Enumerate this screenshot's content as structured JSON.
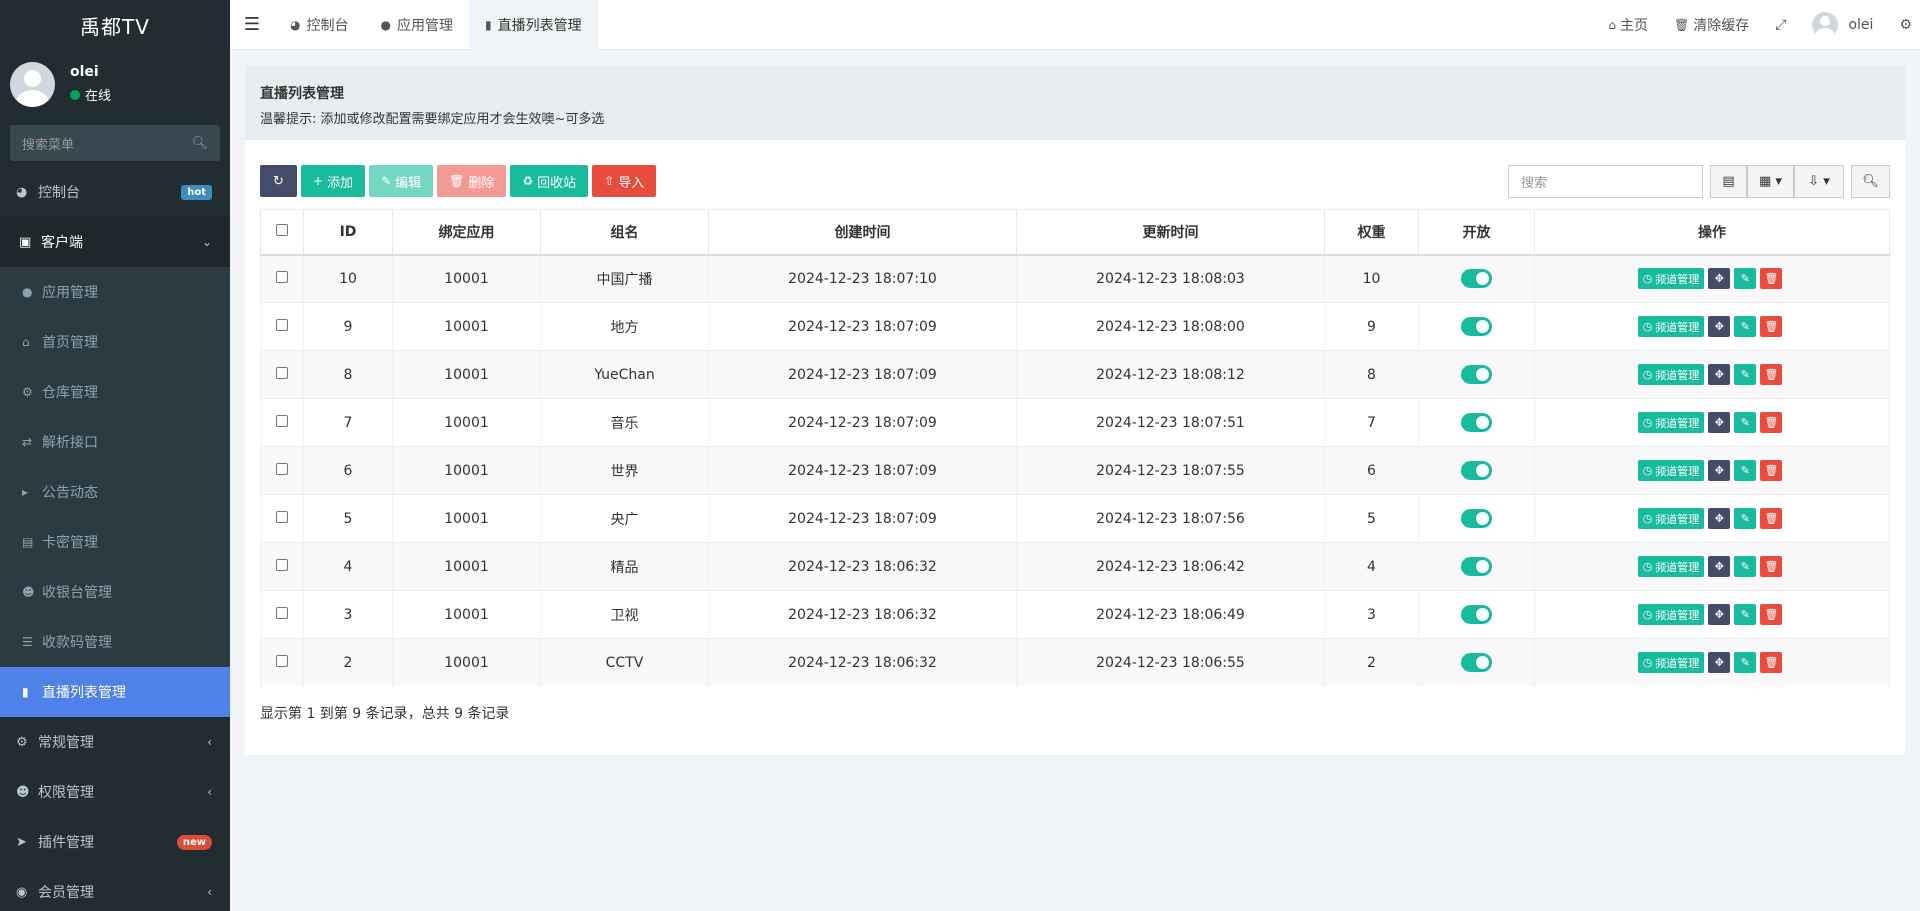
{
  "brand": "禹都TV",
  "user": {
    "name": "olei",
    "status": "在线"
  },
  "sidebar": {
    "search_placeholder": "搜索菜单",
    "items": [
      {
        "label": "控制台",
        "icon": "dashboard-icon",
        "badge": "hot"
      },
      {
        "label": "客户端",
        "icon": "inbox-icon"
      },
      {
        "label": "常规管理",
        "icon": "cogs-icon"
      },
      {
        "label": "权限管理",
        "icon": "users-icon"
      },
      {
        "label": "插件管理",
        "icon": "rocket-icon",
        "badge": "new"
      },
      {
        "label": "会员管理",
        "icon": "user-circle-icon"
      }
    ],
    "sub_items": [
      {
        "label": "应用管理",
        "icon": "android-icon"
      },
      {
        "label": "首页管理",
        "icon": "home-icon"
      },
      {
        "label": "仓库管理",
        "icon": "cogs-icon"
      },
      {
        "label": "解析接口",
        "icon": "usb-icon"
      },
      {
        "label": "公告动态",
        "icon": "bullhorn-icon"
      },
      {
        "label": "卡密管理",
        "icon": "id-card-icon"
      },
      {
        "label": "收银台管理",
        "icon": "user-plus-icon"
      },
      {
        "label": "收款码管理",
        "icon": "list-icon"
      },
      {
        "label": "直播列表管理",
        "icon": "video-icon"
      }
    ]
  },
  "header": {
    "tabs": [
      {
        "label": "控制台",
        "icon": "dashboard-icon"
      },
      {
        "label": "应用管理",
        "icon": "android-icon"
      },
      {
        "label": "直播列表管理",
        "icon": "video-icon"
      }
    ],
    "right": {
      "home": "主页",
      "clear_cache": "清除缓存",
      "user": "olei"
    }
  },
  "page": {
    "title": "直播列表管理",
    "tip": "温馨提示: 添加或修改配置需要绑定应用才会生效噢~可多选",
    "buttons": {
      "add": "添加",
      "edit": "编辑",
      "delete": "删除",
      "recycle": "回收站",
      "import": "导入"
    },
    "search_placeholder": "搜索",
    "summary": "显示第 1 到第 9 条记录，总共 9 条记录"
  },
  "table": {
    "columns": [
      "ID",
      "绑定应用",
      "组名",
      "创建时间",
      "更新时间",
      "权重",
      "开放",
      "操作"
    ],
    "op_label": "频道管理",
    "rows": [
      {
        "id": "10",
        "app": "10001",
        "group": "中国广播",
        "created": "2024-12-23 18:07:10",
        "updated": "2024-12-23 18:08:03",
        "weight": "10",
        "open": true
      },
      {
        "id": "9",
        "app": "10001",
        "group": "地方",
        "created": "2024-12-23 18:07:09",
        "updated": "2024-12-23 18:08:00",
        "weight": "9",
        "open": true
      },
      {
        "id": "8",
        "app": "10001",
        "group": "YueChan",
        "created": "2024-12-23 18:07:09",
        "updated": "2024-12-23 18:08:12",
        "weight": "8",
        "open": true
      },
      {
        "id": "7",
        "app": "10001",
        "group": "音乐",
        "created": "2024-12-23 18:07:09",
        "updated": "2024-12-23 18:07:51",
        "weight": "7",
        "open": true
      },
      {
        "id": "6",
        "app": "10001",
        "group": "世界",
        "created": "2024-12-23 18:07:09",
        "updated": "2024-12-23 18:07:55",
        "weight": "6",
        "open": true
      },
      {
        "id": "5",
        "app": "10001",
        "group": "央广",
        "created": "2024-12-23 18:07:09",
        "updated": "2024-12-23 18:07:56",
        "weight": "5",
        "open": true
      },
      {
        "id": "4",
        "app": "10001",
        "group": "精品",
        "created": "2024-12-23 18:06:32",
        "updated": "2024-12-23 18:06:42",
        "weight": "4",
        "open": true
      },
      {
        "id": "3",
        "app": "10001",
        "group": "卫视",
        "created": "2024-12-23 18:06:32",
        "updated": "2024-12-23 18:06:49",
        "weight": "3",
        "open": true
      },
      {
        "id": "2",
        "app": "10001",
        "group": "CCTV",
        "created": "2024-12-23 18:06:32",
        "updated": "2024-12-23 18:06:55",
        "weight": "2",
        "open": true
      }
    ]
  },
  "colors": {
    "sidebar_bg": "#222d32",
    "active_blue": "#4f82e8",
    "success": "#18bc9c",
    "danger": "#e74c3c",
    "dark_btn": "#444c69"
  }
}
